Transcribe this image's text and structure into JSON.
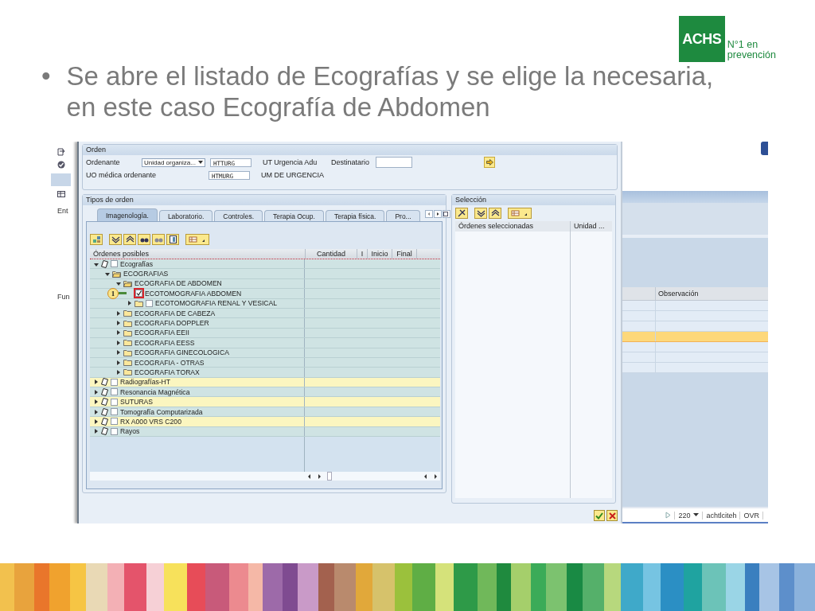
{
  "slide": {
    "logo": {
      "mark": "ACHS",
      "tagline": [
        "N°1 en",
        "prevención"
      ]
    },
    "bullet": "•",
    "text": "Se abre el listado de Ecografías y se elige la necesaria, en este caso Ecografía de Abdomen"
  },
  "background_window": {
    "left_labels": [
      "Ent",
      "Fun"
    ],
    "table": {
      "column_header": "Observación",
      "rows": [
        {
          "selected": false
        },
        {
          "selected": false
        },
        {
          "selected": false
        },
        {
          "selected": true
        },
        {
          "selected": false
        },
        {
          "selected": false
        },
        {
          "selected": false
        }
      ]
    },
    "status_bar": {
      "client": "220",
      "user": "achtlciteh",
      "mode": "OVR"
    }
  },
  "dialog": {
    "order": {
      "title": "Orden",
      "ordering_label": "Ordenante",
      "ordering_type": "Unidad organiza...",
      "ordering_code": "HTTURG",
      "ordering_name": "UT Urgencia Adu",
      "recipient_label": "Destinatario",
      "unit_label": "UO médica ordenante",
      "unit_code": "HTMURG",
      "unit_name": "UM DE URGENCIA"
    },
    "order_types": {
      "title": "Tipos de orden",
      "tabs": [
        {
          "label": "Imagenología.",
          "selected": true
        },
        {
          "label": "Laboratorio.",
          "selected": false
        },
        {
          "label": "Controles.",
          "selected": false
        },
        {
          "label": "Terapia Ocup.",
          "selected": false
        },
        {
          "label": "Terapia física.",
          "selected": false
        },
        {
          "label": "Pro...",
          "selected": false
        }
      ],
      "columns": [
        "Órdenes posibles",
        "Cantidad",
        "I",
        "Inicio",
        "Final"
      ],
      "tree": [
        {
          "label": "Ecografías",
          "kind": "category",
          "expanded": true,
          "checked": false,
          "highlighted": false,
          "children": [
            {
              "label": "ECOGRAFIAS",
              "kind": "folder",
              "expanded": true,
              "highlighted": false,
              "children": [
                {
                  "label": "ECOGRAFIA DE ABDOMEN",
                  "kind": "folder",
                  "expanded": true,
                  "highlighted": false,
                  "children": [
                    {
                      "label": "ECOTOMOGRAFIA ABDOMEN",
                      "kind": "leaf",
                      "checked": true,
                      "highlighted": false,
                      "callout": "1"
                    },
                    {
                      "label": "ECOTOMOGRAFIA RENAL Y VESICAL",
                      "kind": "folder-check",
                      "expanded": false,
                      "checked": false,
                      "highlighted": false
                    }
                  ]
                },
                {
                  "label": "ECOGRAFIA DE CABEZA",
                  "kind": "folder",
                  "expanded": false,
                  "highlighted": false
                },
                {
                  "label": "ECOGRAFIA DOPPLER",
                  "kind": "folder",
                  "expanded": false,
                  "highlighted": false
                },
                {
                  "label": "ECOGRAFIA EEII",
                  "kind": "folder",
                  "expanded": false,
                  "highlighted": false
                },
                {
                  "label": "ECOGRAFIA EESS",
                  "kind": "folder",
                  "expanded": false,
                  "highlighted": false
                },
                {
                  "label": "ECOGRAFIA GINECOLOGICA",
                  "kind": "folder",
                  "expanded": false,
                  "highlighted": false
                },
                {
                  "label": "ECOGRAFIA - OTRAS",
                  "kind": "folder",
                  "expanded": false,
                  "highlighted": false
                },
                {
                  "label": "ECOGRAFIA TORAX",
                  "kind": "folder",
                  "expanded": false,
                  "highlighted": false
                }
              ]
            }
          ]
        },
        {
          "label": "Radiografías-HT",
          "kind": "category",
          "expanded": false,
          "checked": false,
          "highlighted": true
        },
        {
          "label": "Resonancia Magnética",
          "kind": "category",
          "expanded": false,
          "checked": false,
          "highlighted": false
        },
        {
          "label": "SUTURAS",
          "kind": "category",
          "expanded": false,
          "checked": false,
          "highlighted": true
        },
        {
          "label": "Tomografía Computarizada",
          "kind": "category",
          "expanded": false,
          "checked": false,
          "highlighted": false
        },
        {
          "label": "RX A000 VRS C200",
          "kind": "category",
          "expanded": false,
          "checked": false,
          "highlighted": true
        },
        {
          "label": "Rayos",
          "kind": "category",
          "expanded": false,
          "checked": false,
          "highlighted": false
        }
      ]
    },
    "selection": {
      "title": "Selección",
      "columns": [
        "Órdenes seleccionadas",
        "Unidad ..."
      ]
    }
  }
}
